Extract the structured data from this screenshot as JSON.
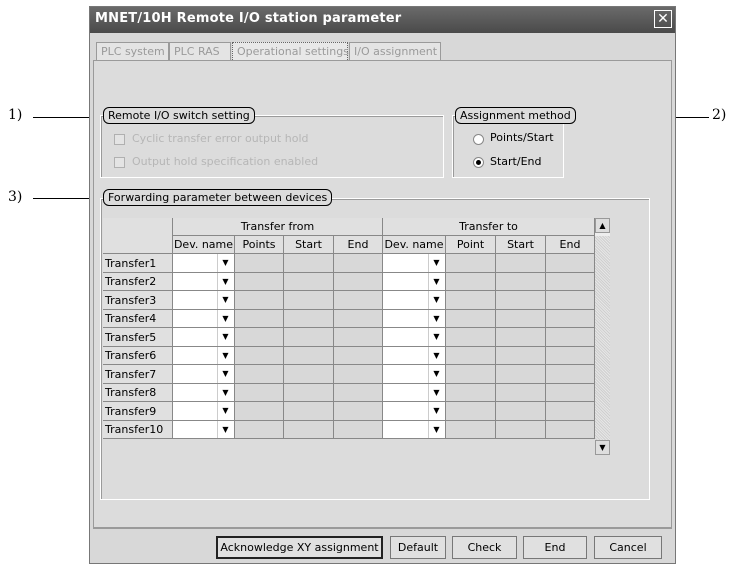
{
  "window": {
    "title": "MNET/10H Remote I/O station parameter",
    "close_symbol": "✕"
  },
  "tabs": [
    {
      "label": "PLC system"
    },
    {
      "label": "PLC RAS"
    },
    {
      "label": "Operational settings"
    },
    {
      "label": "I/O assignment"
    }
  ],
  "remote_io": {
    "label": "Remote I/O switch setting",
    "options": [
      {
        "label": "Cyclic transfer error output hold",
        "checked": false
      },
      {
        "label": "Output hold specification enabled",
        "checked": false
      }
    ]
  },
  "assignment": {
    "label": "Assignment method",
    "options": [
      {
        "label": "Points/Start",
        "selected": false
      },
      {
        "label": "Start/End",
        "selected": true
      }
    ]
  },
  "forwarding": {
    "label": "Forwarding parameter between devices",
    "group_from": "Transfer from",
    "group_to": "Transfer to",
    "columns_from": [
      "Dev. name",
      "Points",
      "Start",
      "End"
    ],
    "columns_to": [
      "Dev. name",
      "Point",
      "Start",
      "End"
    ],
    "rows": [
      "Transfer1",
      "Transfer2",
      "Transfer3",
      "Transfer4",
      "Transfer5",
      "Transfer6",
      "Transfer7",
      "Transfer8",
      "Transfer9",
      "Transfer10"
    ]
  },
  "buttons": {
    "acknowledge": "Acknowledge XY assignment",
    "default": "Default",
    "check": "Check",
    "end": "End",
    "cancel": "Cancel"
  },
  "annotations": {
    "a1": "1)",
    "a2": "2)",
    "a3": "3)"
  }
}
